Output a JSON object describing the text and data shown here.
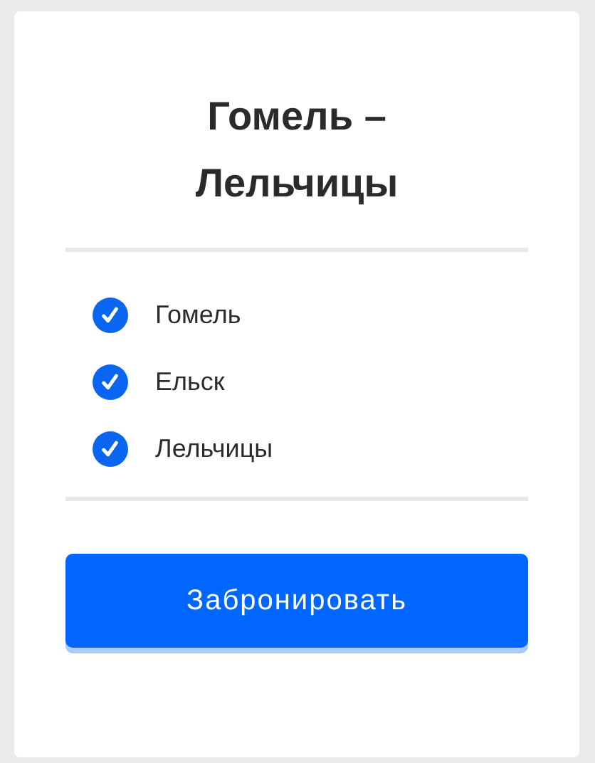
{
  "title": "Гомель – Лельчицы",
  "stops": [
    {
      "label": "Гомель",
      "checked": true
    },
    {
      "label": "Ельск",
      "checked": true
    },
    {
      "label": "Лельчицы",
      "checked": true
    }
  ],
  "button": "Забронировать"
}
